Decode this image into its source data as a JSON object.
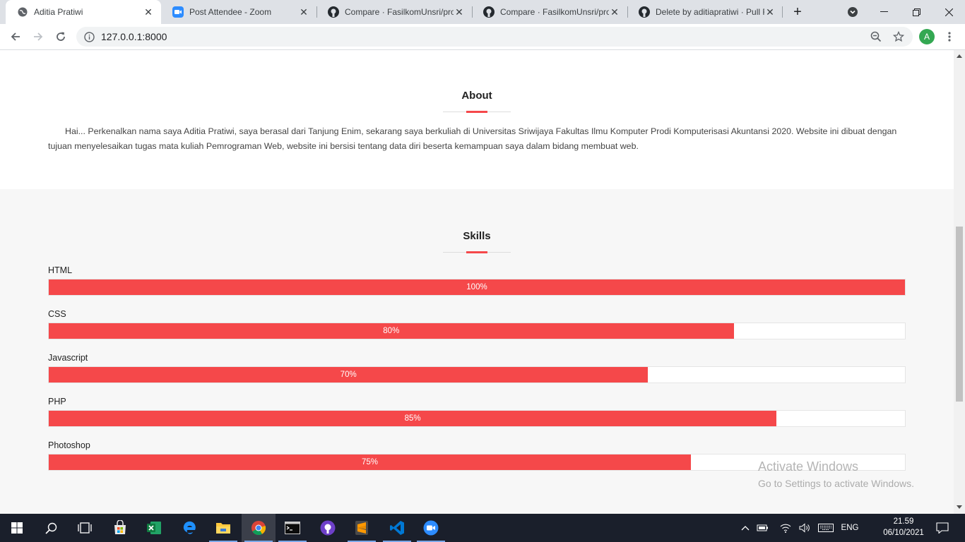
{
  "browser": {
    "tabs": [
      {
        "title": "Aditia Pratiwi",
        "icon": "globe-icon"
      },
      {
        "title": "Post Attendee - Zoom",
        "icon": "zoom-icon"
      },
      {
        "title": "Compare · FasilkomUnsri/proj",
        "icon": "github-icon"
      },
      {
        "title": "Compare · FasilkomUnsri/proj",
        "icon": "github-icon"
      },
      {
        "title": "Delete by aditiapratiwi · Pull R",
        "icon": "github-icon"
      }
    ],
    "url": "127.0.0.1:8000",
    "profile_initial": "A"
  },
  "about": {
    "title": "About",
    "text": "Hai... Perkenalkan nama saya Aditia Pratiwi, saya berasal dari Tanjung Enim, sekarang saya berkuliah di Universitas Sriwijaya Fakultas Ilmu Komputer Prodi Komputerisasi Akuntansi 2020. Website ini dibuat dengan tujuan menyelesaikan tugas mata kuliah Pemrograman Web, website ini bersisi tentang data diri beserta kemampuan saya dalam bidang membuat web."
  },
  "skills": {
    "title": "Skills",
    "items": [
      {
        "name": "HTML",
        "percent": 100,
        "label": "100%"
      },
      {
        "name": "CSS",
        "percent": 80,
        "label": "80%"
      },
      {
        "name": "Javascript",
        "percent": 70,
        "label": "70%"
      },
      {
        "name": "PHP",
        "percent": 85,
        "label": "85%"
      },
      {
        "name": "Photoshop",
        "percent": 75,
        "label": "75%"
      }
    ]
  },
  "watermark": {
    "line1": "Activate Windows",
    "line2": "Go to Settings to activate Windows."
  },
  "taskbar": {
    "language": "ENG",
    "time": "21.59",
    "date": "06/10/2021"
  },
  "colors": {
    "accent": "#f5484a",
    "taskbar": "#1a1f2b"
  }
}
